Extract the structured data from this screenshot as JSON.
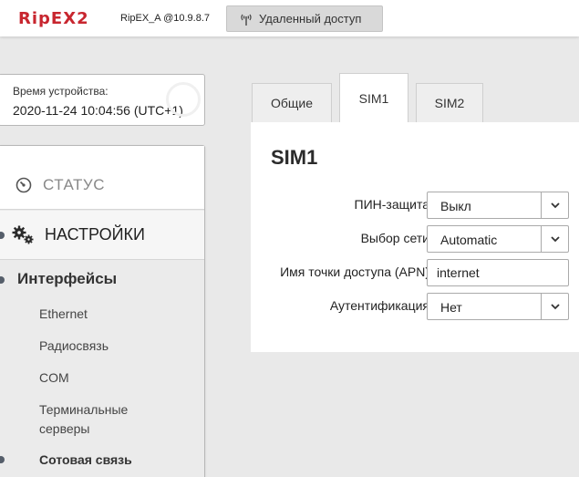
{
  "header": {
    "logo": "RipEX2",
    "device": "RipEX_A @10.9.8.7",
    "remote_access": "Удаленный доступ",
    "brand_color": "#c8262f"
  },
  "device_time": {
    "label": "Время устройства:",
    "value": "2020-11-24 10:04:56 (UTC+1)"
  },
  "sidebar": {
    "status": "СТАТУС",
    "settings": "НАСТРОЙКИ",
    "interfaces": "Интерфейсы",
    "items": [
      "Ethernet",
      "Радиосвязь",
      "COM",
      "Терминальные",
      "серверы",
      "Сотовая связь"
    ]
  },
  "tabs": [
    {
      "label": "Общие",
      "active": false
    },
    {
      "label": "SIM1",
      "active": true
    },
    {
      "label": "SIM2",
      "active": false
    }
  ],
  "panel": {
    "title": "SIM1",
    "pin": {
      "label": "ПИН-защита",
      "value": "Выкл"
    },
    "network": {
      "label": "Выбор сети",
      "value": "Automatic"
    },
    "apn": {
      "label": "Имя точки доступа (APN)",
      "value": "internet"
    },
    "auth": {
      "label": "Аутентификация",
      "value": "Нет"
    }
  },
  "icons": {
    "remote": "antenna-icon",
    "status": "gauge-icon",
    "settings": "gears-icon",
    "select_arrow": "chevron-down-icon"
  }
}
